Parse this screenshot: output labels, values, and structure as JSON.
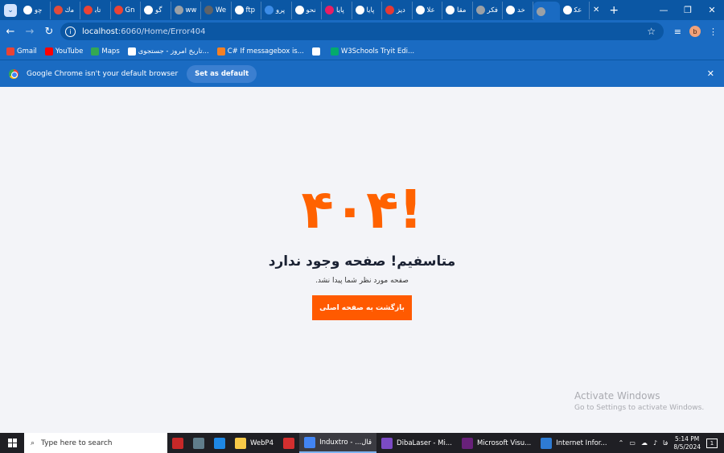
{
  "tabs": [
    {
      "label": "ﭼﻭ",
      "icon": "google-icon",
      "color": "#ffffff"
    },
    {
      "label": "ﻣﻙ",
      "icon": "pin-icon",
      "color": "#e14b3b"
    },
    {
      "label": "ﺗﺎﺑ",
      "icon": "gmail-icon",
      "color": "#ea4335"
    },
    {
      "label": "Gn",
      "icon": "gmail-icon",
      "color": "#ea4335"
    },
    {
      "label": "ﮔﻮ",
      "icon": "google-icon",
      "color": "#ffffff"
    },
    {
      "label": "ww",
      "icon": "globe-icon",
      "color": "#9aa0a6"
    },
    {
      "label": "We",
      "icon": "p-icon",
      "color": "#5f6368"
    },
    {
      "label": "ftp",
      "icon": "google-icon",
      "color": "#ffffff"
    },
    {
      "label": "ﭘﺮﻭ",
      "icon": "arrow-icon",
      "color": "#3c8ce7"
    },
    {
      "label": "ﻧﺤﻮ",
      "icon": "google-icon",
      "color": "#ffffff"
    },
    {
      "label": "ﭘﺎﻳﺎ",
      "icon": "red-circle-icon",
      "color": "#e91e63"
    },
    {
      "label": "ﭘﺎﻳﺎ",
      "icon": "leaf-icon",
      "color": "#ffffff"
    },
    {
      "label": "ﺩﻳﺰ",
      "icon": "bar-icon",
      "color": "#e53935"
    },
    {
      "label": "ﻋﻼ",
      "icon": "google-icon",
      "color": "#ffffff"
    },
    {
      "label": "ﻣﻘﺎ",
      "icon": "leaf-icon",
      "color": "#ffffff"
    },
    {
      "label": "ﻓﻜﺮ",
      "icon": "globe-icon",
      "color": "#9aa0a6"
    },
    {
      "label": "ﺧﺪ",
      "icon": "leaf-icon",
      "color": "#ffffff"
    },
    {
      "label": "",
      "icon": "loading-icon",
      "color": "#9aa0a6",
      "active": true
    },
    {
      "label": "ﻋﻜ",
      "icon": "google-icon",
      "color": "#ffffff"
    }
  ],
  "toolbar": {
    "back": "←",
    "forward": "→",
    "reload": "↻",
    "url_host": "localhost",
    "url_path": ":6060/Home/Error404",
    "profile_letter": "b"
  },
  "bookmarks": [
    {
      "label": "Gmail",
      "icon": "gmail-icon",
      "color": "#ea4335"
    },
    {
      "label": "YouTube",
      "icon": "youtube-icon",
      "color": "#ff0000"
    },
    {
      "label": "Maps",
      "icon": "maps-icon",
      "color": "#34a853"
    },
    {
      "label": "تاریخ امروز - جستجوی...",
      "icon": "google-icon",
      "color": "#ffffff"
    },
    {
      "label": "C# If messagebox is...",
      "icon": "stack-icon",
      "color": "#f48024"
    },
    {
      "label": "",
      "icon": "globe-icon",
      "color": "#ffffff"
    },
    {
      "label": "W3Schools Tryit Edi...",
      "icon": "w3-icon",
      "color": "#04aa6d"
    }
  ],
  "infobar": {
    "message": "Google Chrome isn't your default browser",
    "button": "Set as default"
  },
  "page": {
    "code": "!۴۰۴",
    "title": "متاسفیم! صفحه وجود ندارد",
    "subtitle": "صفحه مورد نظر شما پیدا نشد.",
    "button": "بازگشت به صفحه اصلی",
    "accent": "#ff6200"
  },
  "watermark": {
    "line1": "Activate Windows",
    "line2": "Go to Settings to activate Windows."
  },
  "taskbar": {
    "search_placeholder": "Type here to search",
    "apps": [
      {
        "label": "",
        "icon": "app-2021-icon",
        "color": "#c62828"
      },
      {
        "label": "",
        "icon": "calculator-icon",
        "color": "#607d8b"
      },
      {
        "label": "",
        "icon": "box-icon",
        "color": "#1e88e5"
      },
      {
        "label": "WebP4",
        "icon": "folder-icon",
        "color": "#f7c948"
      },
      {
        "label": "",
        "icon": "autocad-icon",
        "color": "#d32f2f"
      },
      {
        "label": "Induxtro - ...قال",
        "icon": "chrome-icon",
        "color": "#4285f4",
        "active": true
      },
      {
        "label": "DibaLaser - Mi...",
        "icon": "vs-icon",
        "color": "#7b4bc4"
      },
      {
        "label": "Microsoft Visu...",
        "icon": "vs-window-icon",
        "color": "#68217a"
      },
      {
        "label": "Internet Infor...",
        "icon": "iis-icon",
        "color": "#2e7bd3"
      }
    ],
    "lang": "فا",
    "time": "5:14 PM",
    "date": "8/5/2024",
    "notifications": "1"
  }
}
